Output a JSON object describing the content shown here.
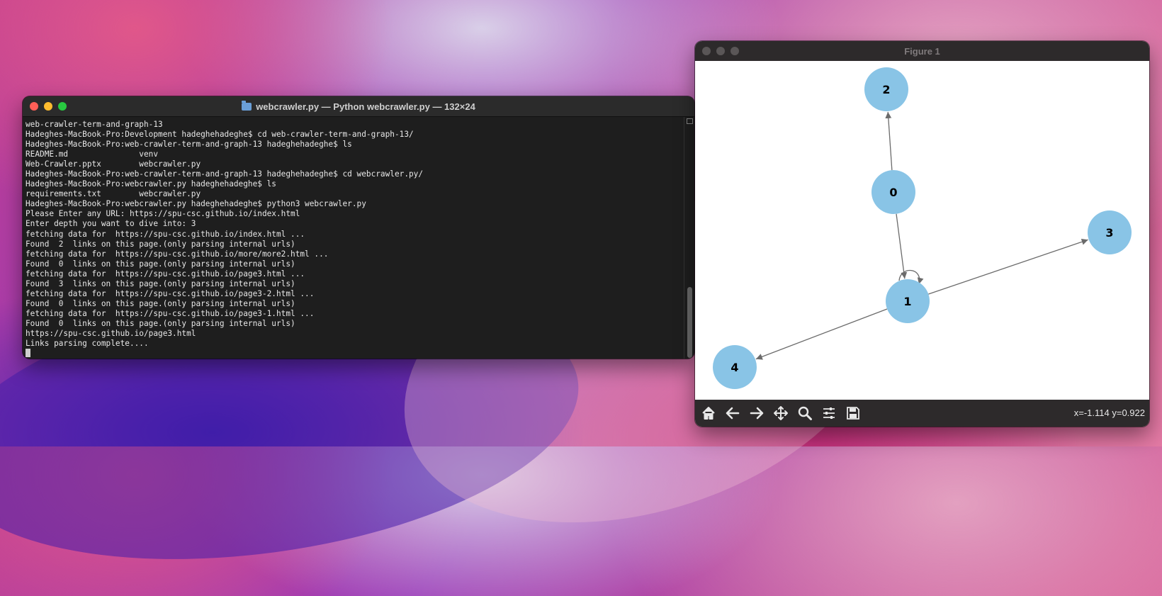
{
  "terminal": {
    "title": "webcrawler.py — Python webcrawler.py — 132×24",
    "lines": [
      "web-crawler-term-and-graph-13",
      "Hadeghes-MacBook-Pro:Development hadeghehadeghe$ cd web-crawler-term-and-graph-13/",
      "Hadeghes-MacBook-Pro:web-crawler-term-and-graph-13 hadeghehadeghe$ ls",
      "README.md               venv",
      "Web-Crawler.pptx        webcrawler.py",
      "Hadeghes-MacBook-Pro:web-crawler-term-and-graph-13 hadeghehadeghe$ cd webcrawler.py/",
      "Hadeghes-MacBook-Pro:webcrawler.py hadeghehadeghe$ ls",
      "requirements.txt        webcrawler.py",
      "Hadeghes-MacBook-Pro:webcrawler.py hadeghehadeghe$ python3 webcrawler.py",
      "Please Enter any URL: https://spu-csc.github.io/index.html",
      "Enter depth you want to dive into: 3",
      "fetching data for  https://spu-csc.github.io/index.html ...",
      "Found  2  links on this page.(only parsing internal urls)",
      "fetching data for  https://spu-csc.github.io/more/more2.html ...",
      "Found  0  links on this page.(only parsing internal urls)",
      "fetching data for  https://spu-csc.github.io/page3.html ...",
      "Found  3  links on this page.(only parsing internal urls)",
      "fetching data for  https://spu-csc.github.io/page3-2.html ...",
      "Found  0  links on this page.(only parsing internal urls)",
      "fetching data for  https://spu-csc.github.io/page3-1.html ...",
      "Found  0  links on this page.(only parsing internal urls)",
      "https://spu-csc.github.io/page3.html",
      "Links parsing complete...."
    ]
  },
  "figure": {
    "title": "Figure 1",
    "coords": "x=-1.114 y=0.922",
    "node_color": "#89c4e6",
    "edge_color": "#6b6b6b",
    "nodes": [
      {
        "label": "0"
      },
      {
        "label": "1"
      },
      {
        "label": "2"
      },
      {
        "label": "3"
      },
      {
        "label": "4"
      }
    ],
    "edges": [
      {
        "from": "0",
        "to": "2"
      },
      {
        "from": "0",
        "to": "1"
      },
      {
        "from": "1",
        "to": "1"
      },
      {
        "from": "1",
        "to": "3"
      },
      {
        "from": "1",
        "to": "4"
      }
    ],
    "toolbar": [
      "home-icon",
      "back-arrow-icon",
      "forward-arrow-icon",
      "pan-icon",
      "zoom-icon",
      "configure-subplots-icon",
      "save-icon"
    ]
  }
}
